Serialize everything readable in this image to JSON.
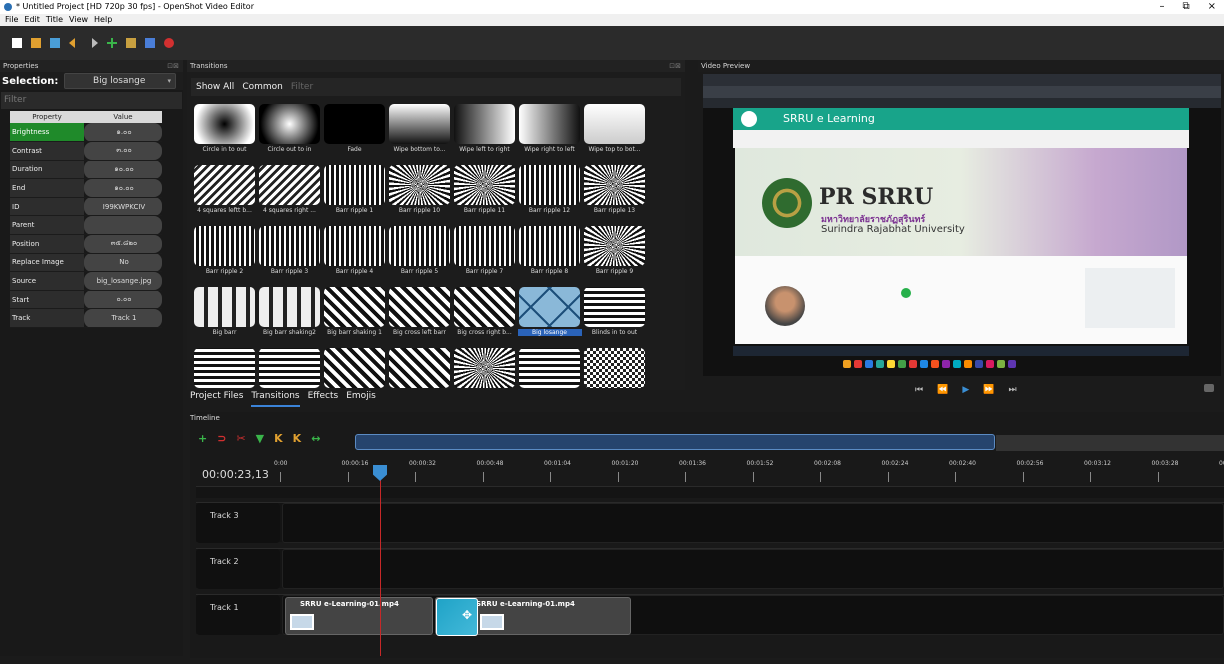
{
  "window": {
    "title": "* Untitled Project [HD 720p 30 fps] - OpenShot Video Editor",
    "min": "–",
    "max": "⧉",
    "close": "×"
  },
  "menu": [
    "File",
    "Edit",
    "Title",
    "View",
    "Help"
  ],
  "toolbar": {
    "icons": [
      "new-project-icon",
      "open-project-icon",
      "save-project-icon",
      "undo-icon",
      "redo-icon",
      "import-files-icon",
      "profile-icon",
      "fullscreen-icon",
      "export-video-icon"
    ],
    "colors": {
      "new": "#ffffff",
      "open": "#e0a030",
      "save": "#4a9ed8",
      "undo": "#e0a030",
      "redo": "#bbbbbb",
      "import": "#3ab54a",
      "profile": "#c8a040",
      "export": "#d23030"
    }
  },
  "properties": {
    "dock_title": "Properties",
    "selection_label": "Selection:",
    "selection_value": "Big losange",
    "filter_placeholder": "Filter",
    "col_property": "Property",
    "col_value": "Value",
    "rows": [
      {
        "name": "Brightness",
        "value": "๑.๐๐"
      },
      {
        "name": "Contrast",
        "value": "๓.๐๐"
      },
      {
        "name": "Duration",
        "value": "๑๐.๐๐"
      },
      {
        "name": "End",
        "value": "๑๐.๐๐"
      },
      {
        "name": "ID",
        "value": "I99KWPKCIV"
      },
      {
        "name": "Parent",
        "value": ""
      },
      {
        "name": "Position",
        "value": "๓๕.๘๒๐"
      },
      {
        "name": "Replace Image",
        "value": "No"
      },
      {
        "name": "Source",
        "value": "big_losange.jpg"
      },
      {
        "name": "Start",
        "value": "๐.๐๐"
      },
      {
        "name": "Track",
        "value": "Track 1"
      }
    ]
  },
  "transitions": {
    "dock_title": "Transitions",
    "tab_all": "Show All",
    "tab_common": "Common",
    "filter_placeholder": "Filter",
    "items": [
      {
        "label": "Circle in to out",
        "cls": "g1"
      },
      {
        "label": "Circle out to in",
        "cls": "g2"
      },
      {
        "label": "Fade",
        "cls": "g3"
      },
      {
        "label": "Wipe bottom to...",
        "cls": "g4"
      },
      {
        "label": "Wipe left to right",
        "cls": "g5"
      },
      {
        "label": "Wipe right to left",
        "cls": "g6"
      },
      {
        "label": "Wipe top to bot...",
        "cls": "g7"
      },
      {
        "label": "4 squares leftt b...",
        "cls": "st"
      },
      {
        "label": "4 squares right ...",
        "cls": "st"
      },
      {
        "label": "Barr ripple 1",
        "cls": "st2"
      },
      {
        "label": "Barr ripple 10",
        "cls": "st3"
      },
      {
        "label": "Barr ripple 11",
        "cls": "st3"
      },
      {
        "label": "Barr ripple 12",
        "cls": "st2"
      },
      {
        "label": "Barr ripple 13",
        "cls": "st3"
      },
      {
        "label": "Barr ripple 2",
        "cls": "st2"
      },
      {
        "label": "Barr ripple 3",
        "cls": "st2"
      },
      {
        "label": "Barr ripple 4",
        "cls": "st2"
      },
      {
        "label": "Barr ripple 5",
        "cls": "st2"
      },
      {
        "label": "Barr ripple 7",
        "cls": "st2"
      },
      {
        "label": "Barr ripple 8",
        "cls": "st2"
      },
      {
        "label": "Barr ripple 9",
        "cls": "st3"
      },
      {
        "label": "Big barr",
        "cls": "st6"
      },
      {
        "label": "Big barr shaking2",
        "cls": "st6"
      },
      {
        "label": "Big barr shaking 1",
        "cls": "st5"
      },
      {
        "label": "Big cross left barr",
        "cls": "st5"
      },
      {
        "label": "Big cross right b...",
        "cls": "st5"
      },
      {
        "label": "Big losange",
        "cls": "dm",
        "selected": true
      },
      {
        "label": "Blinds in to out",
        "cls": "st4"
      },
      {
        "label": "",
        "cls": "st4"
      },
      {
        "label": "",
        "cls": "st4"
      },
      {
        "label": "",
        "cls": "st5"
      },
      {
        "label": "",
        "cls": "st5"
      },
      {
        "label": "",
        "cls": "st3"
      },
      {
        "label": "",
        "cls": "st4"
      },
      {
        "label": "",
        "cls": "ck"
      }
    ]
  },
  "project_tabs": [
    "Project Files",
    "Transitions",
    "Effects",
    "Emojis"
  ],
  "preview": {
    "dock_title": "Video Preview",
    "site_name": "SRRU e Learning",
    "banner_title": "PR SRRU",
    "banner_thai": "มหาวิทยาลัยราชภัฏสุรินทร์",
    "banner_en": "Surindra Rajabhat University",
    "controls": [
      "⏮",
      "⏪",
      "▶",
      "⏩",
      "⏭"
    ]
  },
  "timeline": {
    "dock_title": "Timeline",
    "timecode": "00:00:23,13",
    "ticks": [
      "0:00",
      "00:00:16",
      "00:00:32",
      "00:00:48",
      "00:01:04",
      "00:01:20",
      "00:01:36",
      "00:01:52",
      "00:02:08",
      "00:02:24",
      "00:02:40",
      "00:02:56",
      "00:03:12",
      "00:03:28",
      "00:"
    ],
    "tracks": [
      "Track 3",
      "Track 2",
      "Track 1"
    ],
    "clip1": "SRRU e-Learning-01.mp4",
    "clip2": "SRRU e-Learning-01.mp4",
    "tools": [
      "add-track-icon",
      "snap-magnet-icon",
      "razor-icon",
      "add-marker-icon",
      "previous-marker-icon",
      "next-marker-icon",
      "center-playhead-icon"
    ]
  }
}
